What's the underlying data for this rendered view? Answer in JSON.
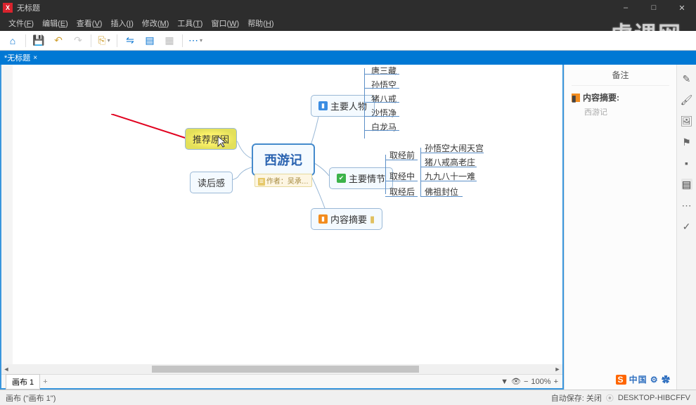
{
  "window": {
    "title": "无标题",
    "app_icon_text": "X"
  },
  "window_controls": {
    "min": "–",
    "max": "□",
    "close": "✕"
  },
  "menus": [
    {
      "label": "文件",
      "accel": "F"
    },
    {
      "label": "编辑",
      "accel": "E"
    },
    {
      "label": "查看",
      "accel": "V"
    },
    {
      "label": "插入",
      "accel": "I"
    },
    {
      "label": "修改",
      "accel": "M"
    },
    {
      "label": "工具",
      "accel": "T"
    },
    {
      "label": "窗口",
      "accel": "W"
    },
    {
      "label": "帮助",
      "accel": "H"
    }
  ],
  "toolbar_icons": {
    "home": "⌂",
    "save": "💾",
    "undo": "↶",
    "redo": "↷",
    "export": "⎘",
    "share": "⇋",
    "package": "▤",
    "presentation": "▦",
    "more": "⋯"
  },
  "tab": {
    "label": "*无标题",
    "close": "×"
  },
  "mindmap": {
    "root": "西游记",
    "author_label": "作者：吴承…",
    "reason_node": "推荐原因",
    "feeling_node": "读后感",
    "characters_node": "主要人物",
    "plot_node": "主要情节",
    "summary_node": "内容摘要",
    "characters": [
      "唐三藏",
      "孙悟空",
      "猪八戒",
      "沙悟净",
      "白龙马"
    ],
    "plot_phases": [
      "取经前",
      "取经中",
      "取经后"
    ],
    "plot_events": [
      "孙悟空大闹天宫",
      "猪八戒高老庄",
      "九九八十一难",
      "佛祖封位"
    ]
  },
  "sheet": {
    "name": "画布 1",
    "add": "+"
  },
  "zoom": {
    "filter": "▼",
    "eye": "👁",
    "minus": "−",
    "value": "100%",
    "plus": "+"
  },
  "notes": {
    "panel_title": "备注",
    "heading": "内容摘要:",
    "body": "西游记"
  },
  "rail_icons": {
    "style": "✎",
    "brush": "🖌",
    "image": "🖼",
    "flag": "⚑",
    "pin": "▪",
    "notes": "▤",
    "comments": "⋯",
    "task": "✓"
  },
  "brand": {
    "s": "S",
    "text": "中国 ⚙ ✿"
  },
  "status": {
    "left": "画布 (\"画布 1\")",
    "autosave": "自动保存: 关闭",
    "desktop": "DESKTOP-HIBCFFV"
  },
  "watermark": "虎课网",
  "chart_data": {
    "type": "mindmap",
    "title": "西游记",
    "root": {
      "label": "西游记",
      "note": "作者：吴承…",
      "children": [
        {
          "label": "推荐原因",
          "side": "left",
          "selected": true
        },
        {
          "label": "读后感",
          "side": "left"
        },
        {
          "label": "主要人物",
          "side": "right",
          "marker": "blue-square",
          "children": [
            {
              "label": "唐三藏"
            },
            {
              "label": "孙悟空"
            },
            {
              "label": "猪八戒"
            },
            {
              "label": "沙悟净"
            },
            {
              "label": "白龙马"
            }
          ]
        },
        {
          "label": "主要情节",
          "side": "right",
          "marker": "green-check",
          "children": [
            {
              "label": "取经前",
              "children": [
                {
                  "label": "孙悟空大闹天宫"
                }
              ]
            },
            {
              "label": "取经中",
              "children": [
                {
                  "label": "猪八戒高老庄"
                },
                {
                  "label": "九九八十一难"
                }
              ]
            },
            {
              "label": "取经后",
              "children": [
                {
                  "label": "佛祖封位"
                }
              ]
            }
          ]
        },
        {
          "label": "内容摘要",
          "side": "right",
          "marker": "orange-square"
        }
      ]
    }
  }
}
